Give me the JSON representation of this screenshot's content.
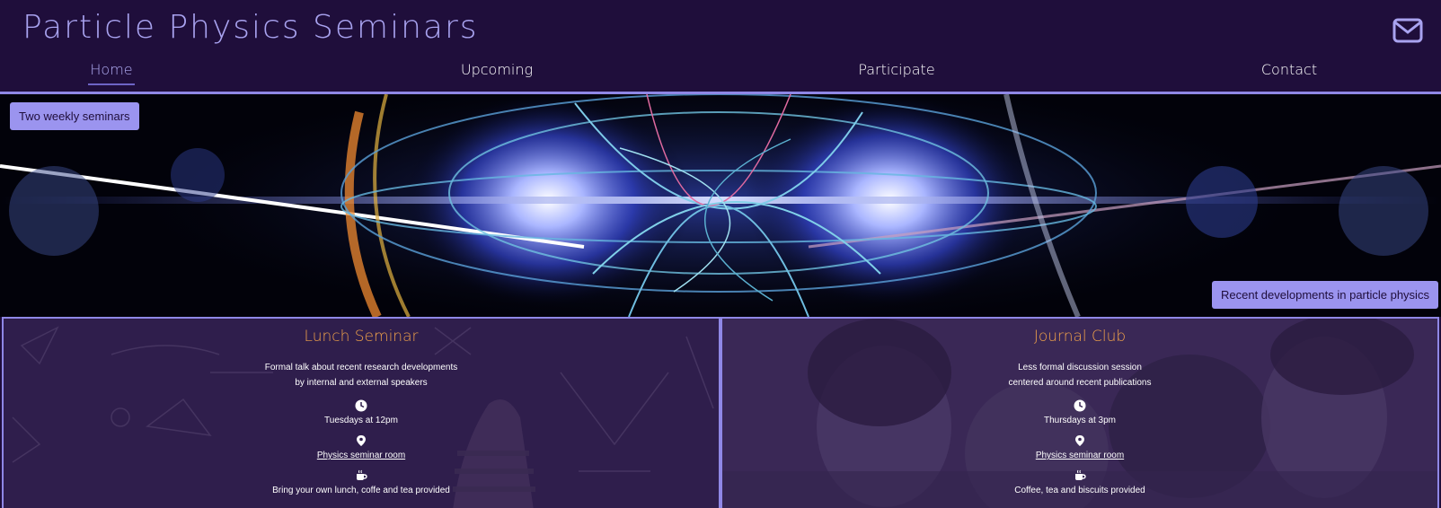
{
  "header": {
    "title": "Particle Physics Seminars",
    "mail_icon": "envelope-icon"
  },
  "nav": [
    {
      "label": "Home",
      "active": true
    },
    {
      "label": "Upcoming",
      "active": false
    },
    {
      "label": "Participate",
      "active": false
    },
    {
      "label": "Contact",
      "active": false
    }
  ],
  "hero": {
    "tag_left": "Two weekly seminars",
    "tag_right": "Recent developments in particle physics"
  },
  "lunch": {
    "title": "Lunch Seminar",
    "desc_line1": "Formal talk about recent research developments",
    "desc_line2": "by internal and external speakers",
    "time": "Tuesdays at 12pm",
    "location": "Physics seminar room",
    "catering": "Bring your own lunch, coffe and tea provided"
  },
  "journal": {
    "title": "Journal Club",
    "desc_line1": "Less formal discussion session",
    "desc_line2": "centered around recent publications",
    "time": "Thursdays at 3pm",
    "location": "Physics seminar room",
    "catering": "Coffee, tea and biscuits provided"
  },
  "colors": {
    "background": "#1f0e3b",
    "accent": "#9b94ef",
    "title_orange": "#f0a24a"
  }
}
